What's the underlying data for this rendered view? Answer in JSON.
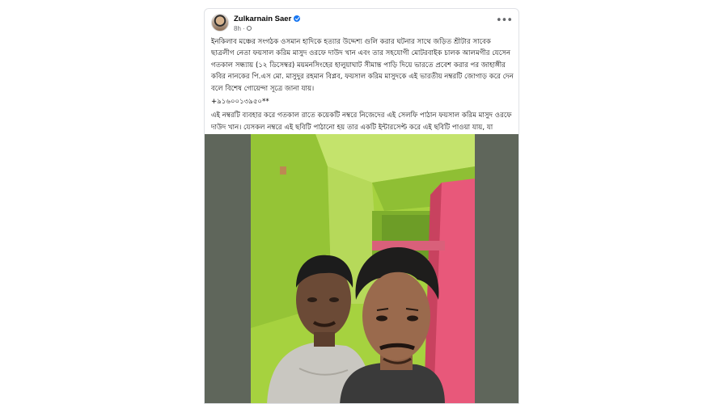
{
  "post": {
    "author": "Zulkarnain Saer",
    "time": "8h ·",
    "paragraph_1": "ইনকিলাব মঞ্চের সংগঠক ওসমান হাদিকে হত্যার উদ্দেশ্য গুলি করার ঘটনার সাথে জড়িত শ্রীটার সাবেক ছাত্রলীগ নেতা ফয়সাল করিম মাসুদ ওরফে দাউদ খান এবং তার সহযোগী মোটরবাইক চালক আলমগীর যেসেন গতকাল সন্ধ্যায় (১২ ডিসেম্বর) ময়মনসিংহের হালুয়াঘাট সীমান্ত পাড়ি দিয়ে ভারতে প্রবেশ করার পর জাহাঙ্গীর কবির নানকের পি.এস মো. মাসুদুর রহমান বিপ্লব, ফয়সাল করিম মাসুদকে এই ভারতীয় নম্বরটি জোগাড় করে দেন বলে বিশেষ গোয়েন্দা সূত্রে জানা যায়।",
    "phone": "+৯১৬০০১৩৯৫০**",
    "paragraph_2": "এই নম্বরটি ব্যবহার করে গতকাল রাতে কয়েকটি নম্বরে নিজেদের এই সেলফি পাঠান ফয়সাল করিম মাসুদ ওরফে দাউদ খান। যেসকল নম্বরে এই ছবিটি পাঠানো হয় তার একটি ইন্টারসেপ্ট করে এই ছবিটি পাওয়া যায়, যা গতকাল ভারতের আসাম রাজ্যের গুয়াহাটিতে তোলা হয়েছে বলে নিশ্চিত হওয়া গেছে।"
  },
  "icons": {
    "more": "more-horizontal-icon",
    "verified": "verified-badge-icon",
    "audience": "globe-icon"
  },
  "colors": {
    "verified": "#1877f2",
    "photo_frame": "#5f665b",
    "wall_green": "#9dcc3a",
    "wall_pink": "#e8587a"
  }
}
